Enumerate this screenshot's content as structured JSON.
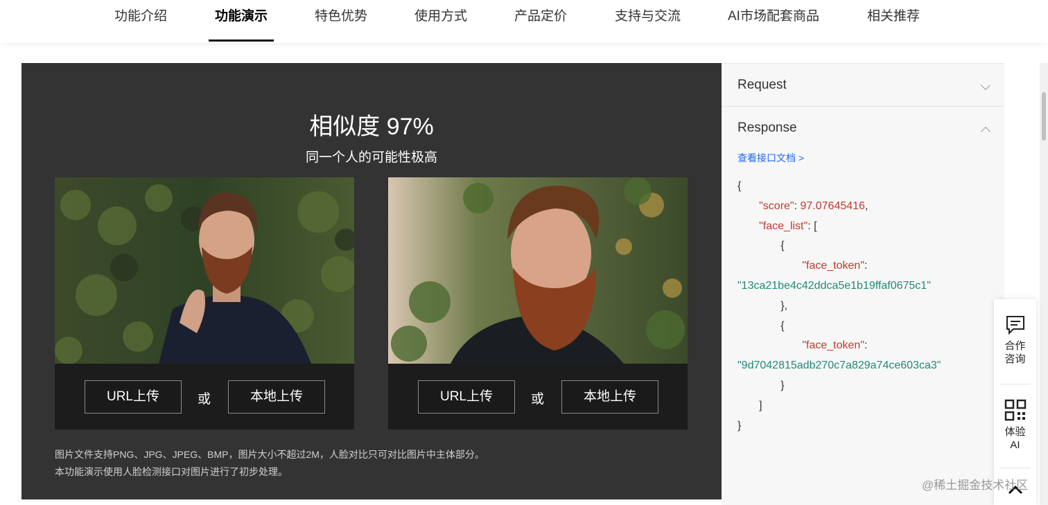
{
  "nav": {
    "items": [
      {
        "label": "功能介绍"
      },
      {
        "label": "功能演示"
      },
      {
        "label": "特色优势"
      },
      {
        "label": "使用方式"
      },
      {
        "label": "产品定价"
      },
      {
        "label": "支持与交流"
      },
      {
        "label": "AI市场配套商品"
      },
      {
        "label": "相关推荐"
      }
    ],
    "active": "功能演示"
  },
  "demo": {
    "title": "相似度 97%",
    "subtitle": "同一个人的可能性极高",
    "cards": [
      {
        "url_label": "URL上传",
        "or_label": "或",
        "local_label": "本地上传"
      },
      {
        "url_label": "URL上传",
        "or_label": "或",
        "local_label": "本地上传"
      }
    ],
    "notes": [
      "图片文件支持PNG、JPG、JPEG、BMP，图片大小不超过2M，人脸对比只可对比图片中主体部分。",
      "本功能演示使用人脸检测接口对图片进行了初步处理。"
    ]
  },
  "side": {
    "request_title": "Request",
    "response_title": "Response",
    "doc_link": "查看接口文档 >",
    "json": {
      "open_brace": "{",
      "score_key": "\"score\"",
      "score_value": "97.07645416",
      "face_list_key": "\"face_list\"",
      "token_key": "\"face_token\"",
      "token1": "\"13ca21be4c42ddca5e1b19ffaf0675c1\"",
      "token2": "\"9d7042815adb270c7a829a74ce603ca3\"",
      "close_brace": "}"
    }
  },
  "float": {
    "consult_label_1": "合作",
    "consult_label_2": "咨询",
    "try_label_1": "体验",
    "try_label_2": "AI"
  },
  "watermark": "@稀土掘金技术社区",
  "colors": {
    "panel_bg": "#333333",
    "card_bg": "#1c1c1c",
    "json_key": "#c0392b",
    "json_string": "#1f8a78",
    "link": "#2468f2"
  }
}
